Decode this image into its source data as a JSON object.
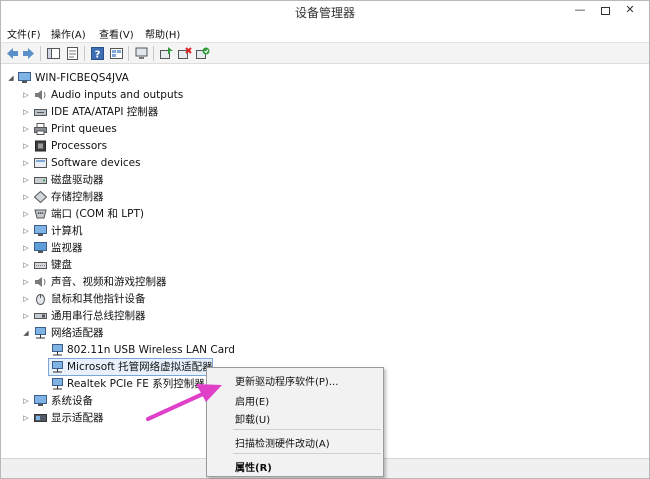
{
  "window": {
    "title": "设备管理器"
  },
  "menu": [
    {
      "label": "文件(F)"
    },
    {
      "label": "操作(A)"
    },
    {
      "label": "查看(V)"
    },
    {
      "label": "帮助(H)"
    }
  ],
  "toolbar": {
    "buttons": [
      "back-icon",
      "forward-icon",
      "console-tree-icon",
      "properties-icon",
      "help-icon",
      "view-icon",
      "device-icon",
      "update-driver-icon",
      "uninstall-icon",
      "enable-device-icon"
    ]
  },
  "tree": {
    "root": "WIN-FICBEQS4JVA",
    "items": [
      {
        "label": "Audio inputs and outputs",
        "icon": "speaker-icon"
      },
      {
        "label": "IDE ATA/ATAPI 控制器",
        "icon": "ide-controller-icon"
      },
      {
        "label": "Print queues",
        "icon": "printer-icon"
      },
      {
        "label": "Processors",
        "icon": "processor-icon"
      },
      {
        "label": "Software devices",
        "icon": "software-device-icon"
      },
      {
        "label": "磁盘驱动器",
        "icon": "disk-drive-icon"
      },
      {
        "label": "存储控制器",
        "icon": "storage-controller-icon"
      },
      {
        "label": "端口 (COM 和 LPT)",
        "icon": "port-icon"
      },
      {
        "label": "计算机",
        "icon": "computer-icon"
      },
      {
        "label": "监视器",
        "icon": "monitor-icon"
      },
      {
        "label": "键盘",
        "icon": "keyboard-icon"
      },
      {
        "label": "声音、视频和游戏控制器",
        "icon": "sound-icon"
      },
      {
        "label": "鼠标和其他指针设备",
        "icon": "mouse-icon"
      },
      {
        "label": "通用串行总线控制器",
        "icon": "usb-icon"
      },
      {
        "label": "网络适配器",
        "icon": "network-adapter-icon"
      }
    ],
    "network_children": [
      {
        "label": "802.11n USB Wireless LAN Card"
      },
      {
        "label": "Microsoft 托管网络虚拟适配器"
      },
      {
        "label": "Realtek PCIe FE 系列控制器"
      }
    ],
    "after_items": [
      {
        "label": "系统设备",
        "icon": "system-device-icon"
      },
      {
        "label": "显示适配器",
        "icon": "display-adapter-icon"
      }
    ]
  },
  "context_menu": {
    "update_driver": "更新驱动程序软件(P)...",
    "enable": "启用(E)",
    "uninstall": "卸载(U)",
    "scan": "扫描检测硬件改动(A)",
    "properties": "属性(R)"
  },
  "colors": {
    "selection_border": "#7aa7d8",
    "selection_fill": "#e8f1fb",
    "arrow": "#e040c8"
  }
}
